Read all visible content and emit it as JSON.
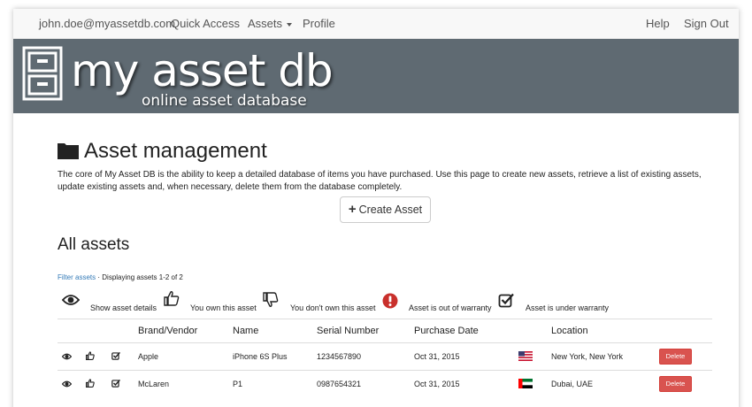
{
  "nav": {
    "user_email": "john.doe@myassetdb.com",
    "quick_access": "Quick Access",
    "assets": "Assets",
    "profile": "Profile",
    "help": "Help",
    "sign_out": "Sign Out"
  },
  "banner": {
    "logo_title": "my asset db",
    "logo_subtitle": "online asset database"
  },
  "page": {
    "title": "Asset management",
    "intro": "The core of My Asset DB is the ability to keep a detailed database of items you have purchased.  Use this page to create new assets, retrieve a list of existing assets, update existing assets and, when necessary, delete them from the database completely.",
    "create_button": "Create Asset",
    "section_title": "All assets",
    "filter_link": "Filter assets",
    "filter_separator": "·",
    "display_count": "Displaying assets 1-2 of 2"
  },
  "legend": {
    "details": "Show asset details",
    "own": "You own this asset",
    "not_own": "You don't own this asset",
    "out_warranty": "Asset is out of warranty",
    "under_warranty": "Asset is under warranty"
  },
  "table": {
    "headers": {
      "brand": "Brand/Vendor",
      "name": "Name",
      "serial": "Serial Number",
      "purchase_date": "Purchase Date",
      "location": "Location"
    },
    "rows": [
      {
        "brand": "Apple",
        "name": "iPhone 6S Plus",
        "serial": "1234567890",
        "purchase_date": "Oct 31, 2015",
        "location": "New York, New York",
        "delete": "Delete"
      },
      {
        "brand": "McLaren",
        "name": "P1",
        "serial": "0987654321",
        "purchase_date": "Oct 31, 2015",
        "location": "Dubai, UAE",
        "delete": "Delete"
      }
    ]
  },
  "colors": {
    "banner": "#5f6a72",
    "link": "#337ab7",
    "danger": "#d9534f",
    "warning_icon": "#c9302c"
  }
}
